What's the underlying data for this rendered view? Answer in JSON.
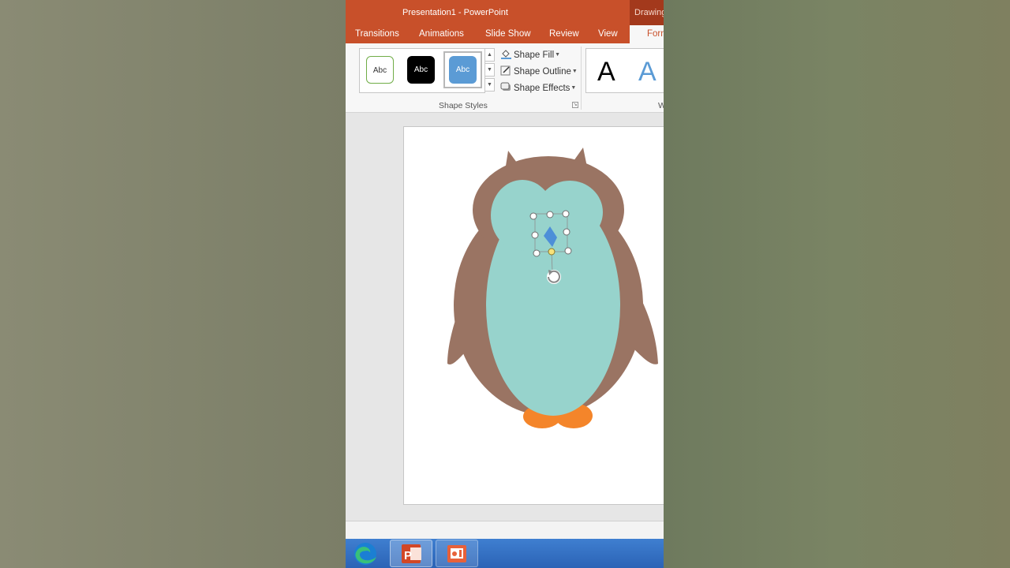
{
  "window": {
    "title": "Presentation1 - PowerPoint",
    "context_tab": "Drawing"
  },
  "tabs": [
    {
      "label": "Transitions"
    },
    {
      "label": "Animations"
    },
    {
      "label": "Slide Show"
    },
    {
      "label": "Review"
    },
    {
      "label": "View"
    }
  ],
  "active_tab": "Forn",
  "ribbon": {
    "shape_styles": {
      "swatches": [
        {
          "label": "Abc"
        },
        {
          "label": "Abc"
        },
        {
          "label": "Abc"
        }
      ],
      "commands": {
        "fill": "Shape Fill",
        "outline": "Shape Outline",
        "effects": "Shape Effects"
      },
      "group_label": "Shape Styles"
    },
    "wordart": {
      "samples": [
        "A",
        "A"
      ],
      "group_label": "W"
    }
  },
  "colors": {
    "accent": "#c8502a",
    "owl_body": "#9a7463",
    "owl_belly": "#97d3cc",
    "owl_feet": "#f4852a",
    "beak": "#4d8fd8",
    "selected_swatch": "#5b9bd5"
  },
  "taskbar": {
    "icons": [
      "edge-icon",
      "powerpoint-icon",
      "presentation-icon"
    ]
  }
}
